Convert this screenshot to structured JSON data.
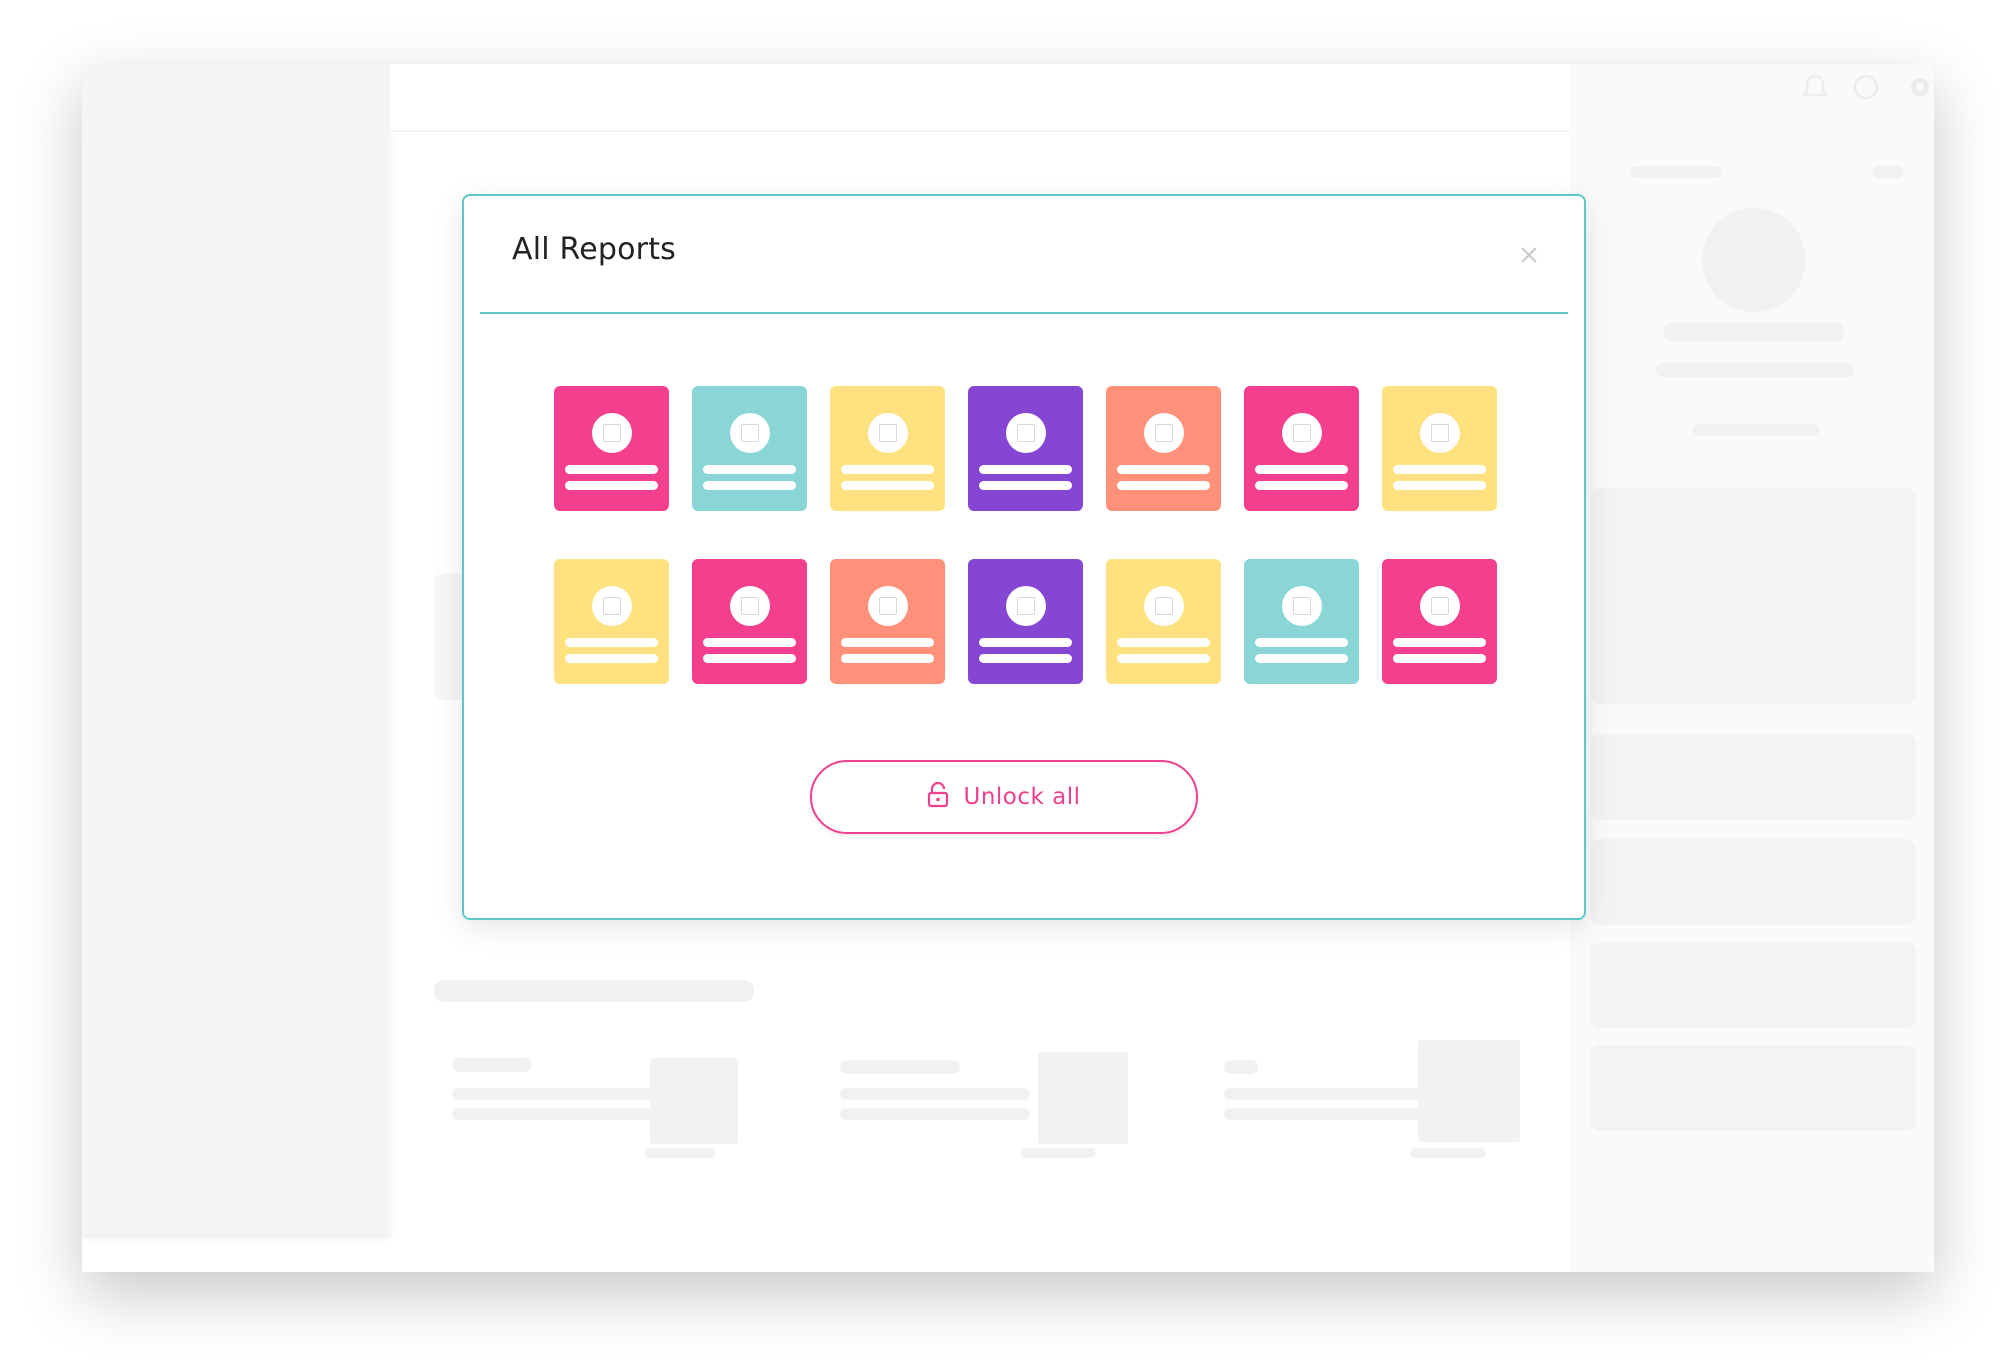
{
  "modal": {
    "title": "All Reports",
    "close_icon": "close-icon",
    "unlock_button": {
      "label": "Unlock all",
      "icon": "unlock-icon"
    },
    "accent_color": "#5ec8c8",
    "button_color": "#ef3f8f"
  },
  "report_cards": [
    {
      "color": "#f33f8e"
    },
    {
      "color": "#8ad6d6"
    },
    {
      "color": "#ffe17f"
    },
    {
      "color": "#8446d3"
    },
    {
      "color": "#ff917a"
    },
    {
      "color": "#f33f8e"
    },
    {
      "color": "#ffe17f"
    },
    {
      "color": "#ffe17f"
    },
    {
      "color": "#f33f8e"
    },
    {
      "color": "#ff917a"
    },
    {
      "color": "#8446d3"
    },
    {
      "color": "#ffe17f"
    },
    {
      "color": "#8ad6d6"
    },
    {
      "color": "#f33f8e"
    }
  ],
  "header_icons": [
    "bell-icon",
    "help-icon",
    "gear-icon"
  ]
}
